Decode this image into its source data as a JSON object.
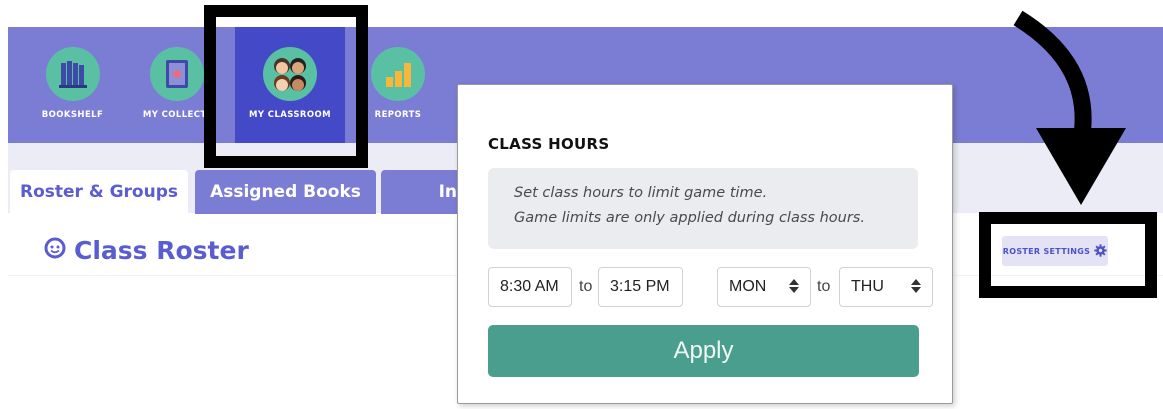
{
  "nav": {
    "items": [
      {
        "label": "BOOKSHELF",
        "icon": "bookshelf-icon"
      },
      {
        "label": "MY COLLECTI",
        "icon": "book-collection-icon"
      },
      {
        "label": "MY CLASSROOM",
        "icon": "classroom-kids-icon"
      },
      {
        "label": "REPORTS",
        "icon": "bar-chart-icon"
      }
    ]
  },
  "tabs": [
    {
      "label": "Roster & Groups",
      "active": true
    },
    {
      "label": "Assigned Books",
      "active": false
    },
    {
      "label": "In",
      "active": false
    }
  ],
  "roster": {
    "title": "Class Roster",
    "settings_label": "ROSTER SETTINGS"
  },
  "class_hours": {
    "title": "CLASS HOURS",
    "info_line1": "Set class hours to limit game time.",
    "info_line2": "Game limits are only applied during class hours.",
    "start_time": "8:30 AM",
    "to1": "to",
    "end_time": "3:15 PM",
    "start_day": "MON",
    "to2": "to",
    "end_day": "THU",
    "apply_label": "Apply"
  },
  "colors": {
    "nav_bg": "#7b7dd5",
    "nav_active": "#4449c7",
    "accent_text": "#5a5dd0",
    "apply_bg": "#4a9e8d",
    "icon_bg": "#59c0a4"
  }
}
